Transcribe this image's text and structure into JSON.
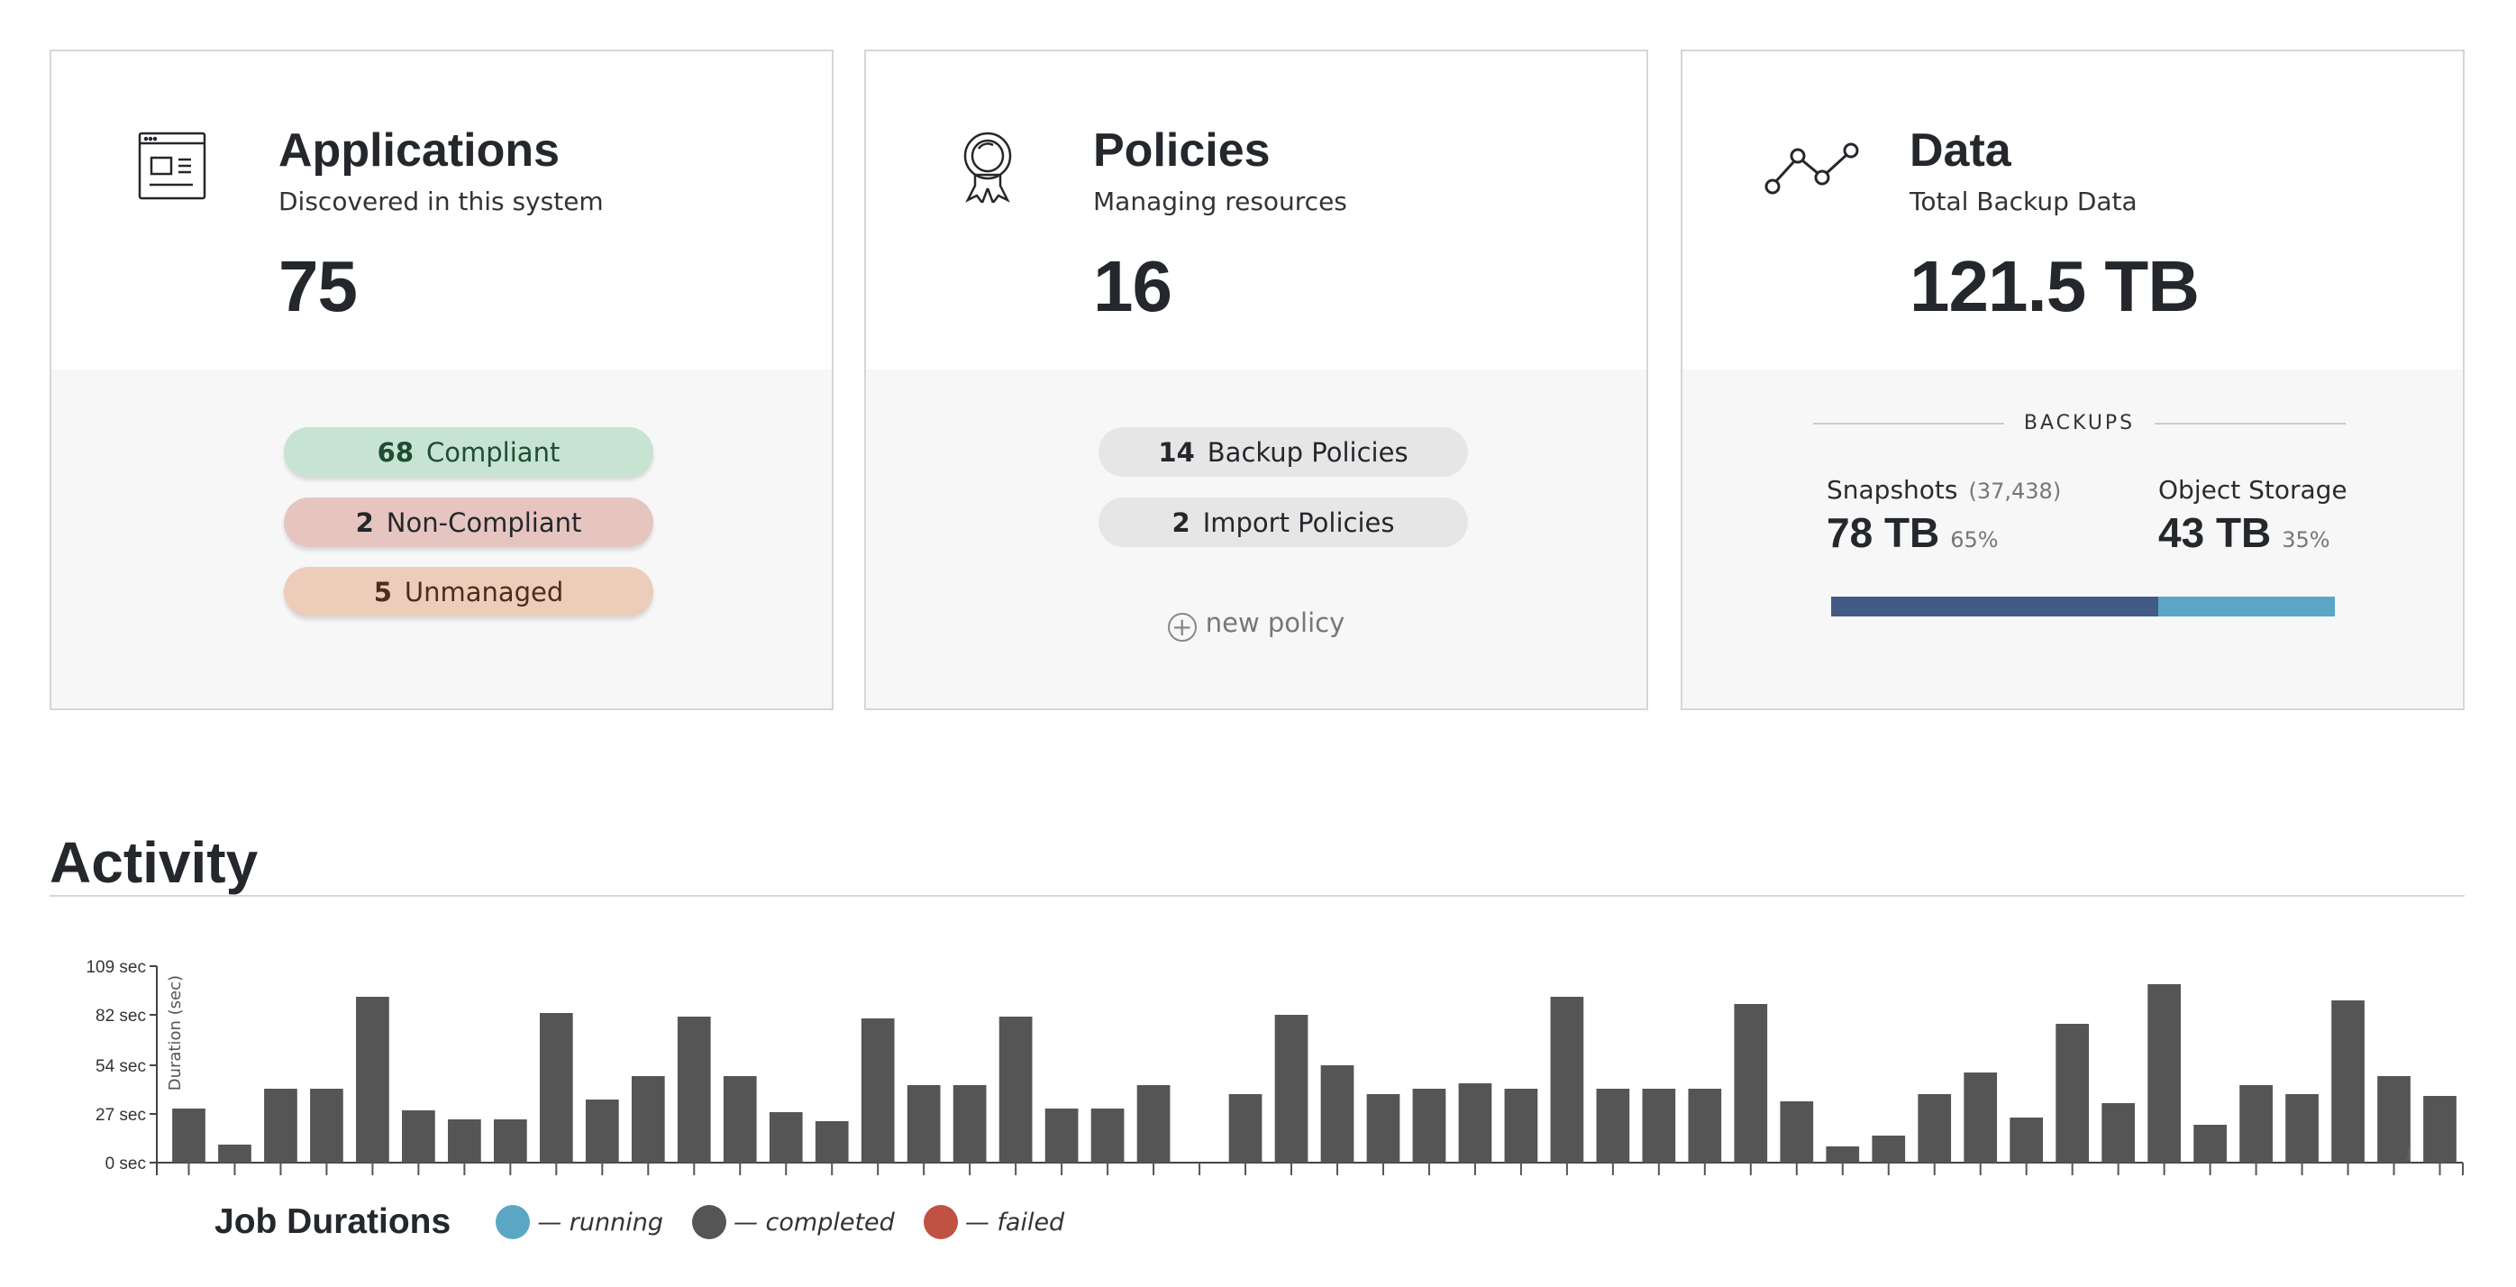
{
  "applications": {
    "title": "Applications",
    "subtitle": "Discovered in this system",
    "count": "75",
    "pills": [
      {
        "count": "68",
        "label": "Compliant",
        "bg": "#c7e3d2",
        "fg": "#1f4d33"
      },
      {
        "count": "2",
        "label": "Non-Compliant",
        "bg": "#e6c5c1",
        "fg": "#24272b"
      },
      {
        "count": "5",
        "label": "Unmanaged",
        "bg": "#ebcdb9",
        "fg": "#4a2d1c"
      }
    ]
  },
  "policies": {
    "title": "Policies",
    "subtitle": "Managing resources",
    "count": "16",
    "pills": [
      {
        "count": "14",
        "label": "Backup Policies"
      },
      {
        "count": "2",
        "label": "Import Policies"
      }
    ],
    "new_policy": "new policy"
  },
  "data": {
    "title": "Data",
    "subtitle": "Total Backup Data",
    "total": "121.5 TB",
    "section": "BACKUPS",
    "snapshots": {
      "label": "Snapshots",
      "count": "(37,438)",
      "value": "78 TB",
      "pct": "65%",
      "fraction": 0.65,
      "color": "#425a85"
    },
    "object": {
      "label": "Object Storage",
      "value": "43 TB",
      "pct": "35%",
      "fraction": 0.35,
      "color": "#5ba6c4"
    }
  },
  "activity": {
    "title": "Activity"
  },
  "chart_data": {
    "type": "bar",
    "ylabel": "Duration (sec)",
    "ylim": [
      0,
      109
    ],
    "yticks": [
      "0 sec",
      "27 sec",
      "54 sec",
      "82 sec",
      "109 sec"
    ],
    "ytick_values": [
      0,
      27,
      54,
      82,
      109
    ],
    "values": [
      30,
      10,
      41,
      41,
      92,
      29,
      24,
      24,
      83,
      35,
      48,
      81,
      48,
      28,
      23,
      80,
      43,
      43,
      81,
      30,
      30,
      43,
      0,
      38,
      82,
      54,
      38,
      41,
      44,
      41,
      92,
      41,
      41,
      41,
      88,
      34,
      9,
      15,
      38,
      50,
      25,
      77,
      33,
      99,
      21,
      43,
      38,
      90,
      48,
      37
    ],
    "bar_color": "#555555",
    "fragment_label": "J",
    "legend": {
      "title": "Job Durations",
      "items": [
        {
          "label": "— running",
          "color": "#5ba6c4"
        },
        {
          "label": "— completed",
          "color": "#555555"
        },
        {
          "label": "— failed",
          "color": "#c05243"
        }
      ]
    }
  }
}
